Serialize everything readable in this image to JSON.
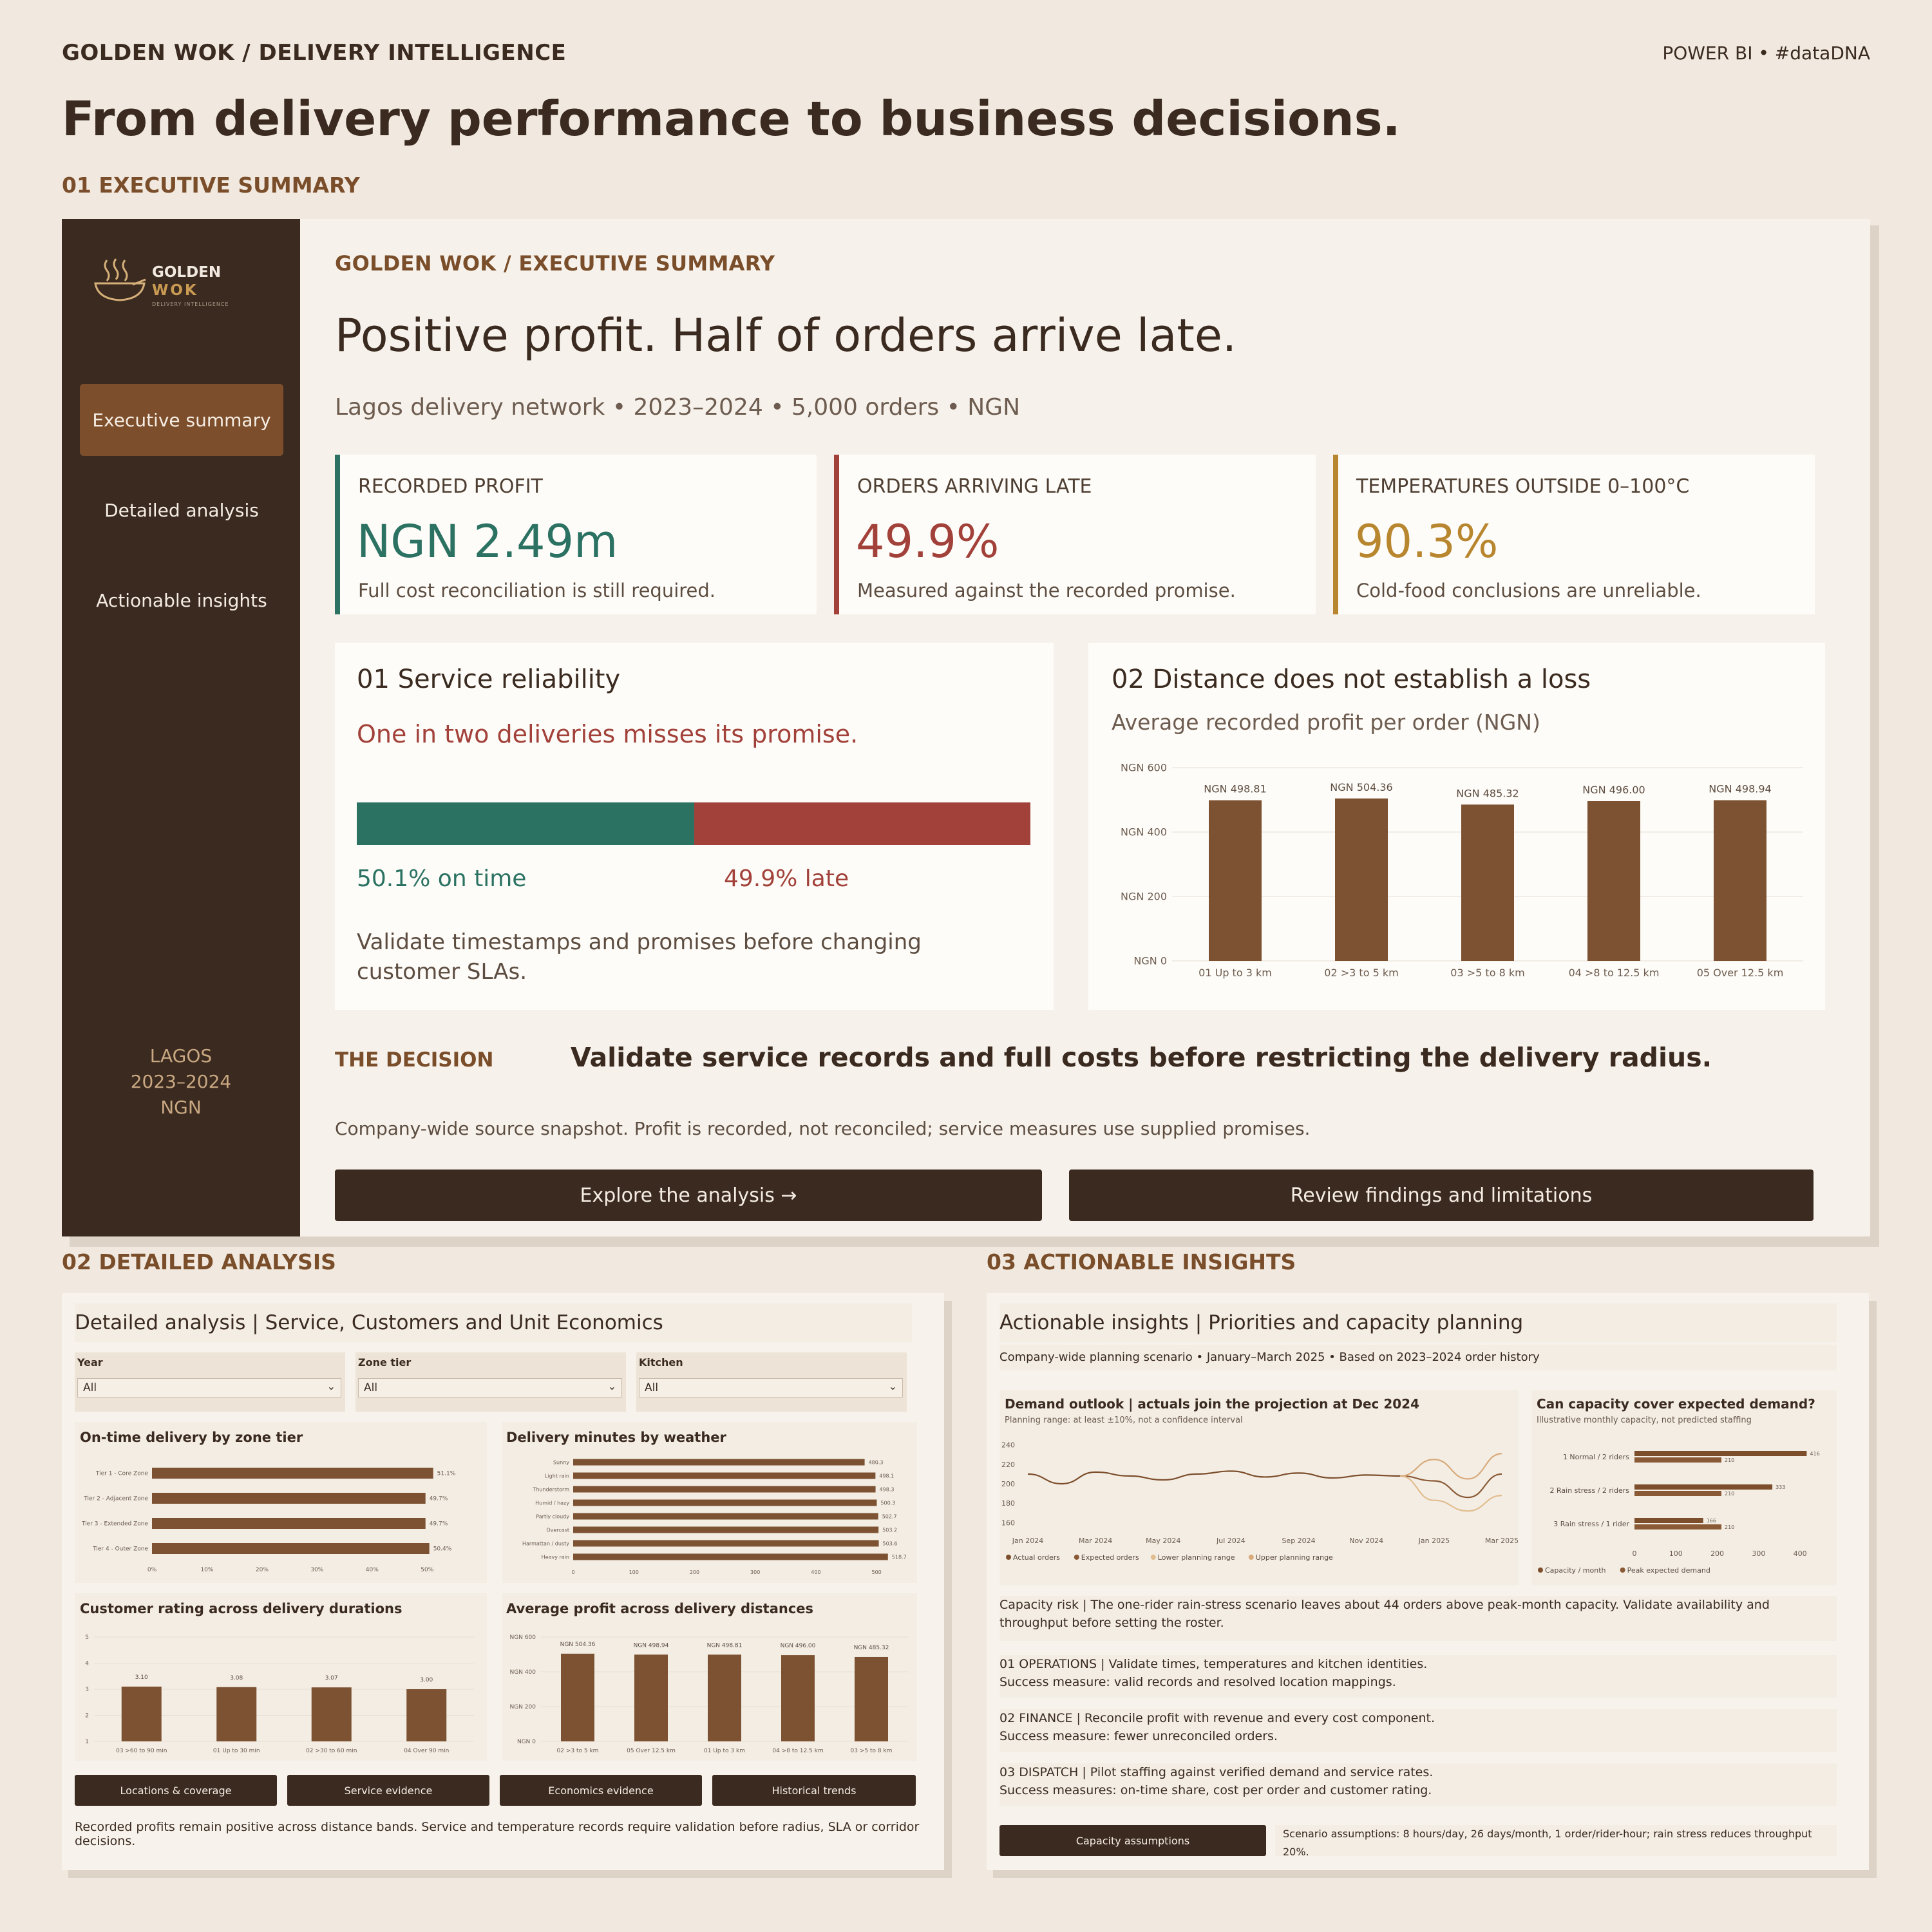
{
  "header": {
    "brand": "GOLDEN WOK  /  DELIVERY INTELLIGENCE",
    "corner": "POWER BI  •  #dataDNA",
    "headline": "From delivery performance to business decisions."
  },
  "sections": {
    "exec": "01  EXECUTIVE SUMMARY",
    "detail": "02  DETAILED ANALYSIS",
    "insights": "03  ACTIONABLE INSIGHTS"
  },
  "sidebar": {
    "logo_line1": "GOLDEN",
    "logo_line2": "WOK",
    "logo_line3": "DELIVERY INTELLIGENCE",
    "nav": [
      "Executive summary",
      "Detailed analysis",
      "Actionable insights"
    ],
    "footer": [
      "LAGOS",
      "2023–2024",
      "NGN"
    ]
  },
  "exec": {
    "breadcrumb": "GOLDEN WOK  /  EXECUTIVE SUMMARY",
    "title": "Positive profit. Half of orders arrive late.",
    "subtitle": "Lagos delivery network  •  2023–2024  •  5,000 orders  •  NGN",
    "kpis": [
      {
        "label": "RECORDED PROFIT",
        "value": "NGN 2.49m",
        "note": "Full cost reconciliation is still required.",
        "color": "#2b7263"
      },
      {
        "label": "ORDERS ARRIVING LATE",
        "value": "49.9%",
        "note": "Measured against the recorded promise.",
        "color": "#a2413a"
      },
      {
        "label": "TEMPERATURES OUTSIDE 0–100°C",
        "value": "90.3%",
        "note": "Cold-food conclusions are unreliable.",
        "color": "#b8862f"
      }
    ],
    "reliability": {
      "title": "01  Service reliability",
      "highlight": "One in two deliveries misses its promise.",
      "on_time_share": 50.1,
      "on_time_label": "50.1% on time",
      "late_label": "49.9% late",
      "note": "Validate timestamps and promises before changing customer SLAs.",
      "on_time_color": "#2b7263",
      "late_color": "#a2413a"
    },
    "distance": {
      "title": "02  Distance does not establish a loss",
      "subtitle": "Average recorded profit per order (NGN)"
    },
    "decision_label": "THE DECISION",
    "decision_text": "Validate service records and full costs before restricting the delivery radius.",
    "footnote": "Company-wide source snapshot. Profit is recorded, not reconciled; service measures use supplied promises.",
    "btn_explore": "Explore the analysis →",
    "btn_review": "Review findings and limitations"
  },
  "detail": {
    "title": "Detailed analysis | Service, Customers and Unit Economics",
    "slicers": [
      {
        "label": "Year",
        "value": "All"
      },
      {
        "label": "Zone tier",
        "value": "All"
      },
      {
        "label": "Kitchen",
        "value": "All"
      }
    ],
    "tiles": {
      "ontime": "On-time delivery by zone tier",
      "weather": "Delivery minutes by weather",
      "rating": "Customer rating across delivery durations",
      "profit": "Average profit across delivery distances"
    },
    "buttons": [
      "Locations & coverage",
      "Service evidence",
      "Economics evidence",
      "Historical trends"
    ],
    "footer": "Recorded profits remain positive across distance bands. Service and temperature records require validation before radius, SLA or corridor decisions."
  },
  "insights": {
    "title": "Actionable insights | Priorities and capacity planning",
    "subtitle": "Company-wide planning scenario • January–March 2025 • Based on 2023–2024 order history",
    "demand_title": "Demand outlook | actuals join the projection at Dec 2024",
    "demand_sub": "Planning range: at least ±10%, not a confidence interval",
    "capacity_title": "Can capacity cover expected demand?",
    "capacity_sub": "Illustrative monthly capacity, not predicted staffing",
    "risk": "Capacity risk  |  The one-rider rain-stress scenario leaves about 44 orders above peak-month capacity. Validate availability and throughput before setting the roster.",
    "actions": [
      {
        "head": "01  OPERATIONS  |  Validate times, temperatures and kitchen identities.",
        "measure": "Success measure: valid records and resolved location mappings."
      },
      {
        "head": "02  FINANCE  |  Reconcile profit with revenue and every cost component.",
        "measure": "Success measure: fewer unreconciled orders."
      },
      {
        "head": "03  DISPATCH  |  Pilot staffing against verified demand and service rates.",
        "measure": "Success measures: on-time share, cost per order and customer rating."
      }
    ],
    "btn_capacity": "Capacity assumptions",
    "assumptions": "Scenario assumptions: 8 hours/day, 26 days/month, 1 order/rider-hour; rain stress reduces throughput 20%."
  },
  "chart_data": [
    {
      "id": "exec-distance",
      "type": "bar",
      "title": "Distance does not establish a loss",
      "ylabel": "Average recorded profit per order (NGN)",
      "categories": [
        "01 Up to 3 km",
        "02 >3 to 5 km",
        "03 >5 to 8 km",
        "04 >8 to 12.5 km",
        "05 Over 12.5 km"
      ],
      "values": [
        498.81,
        504.36,
        485.32,
        496.0,
        498.94
      ],
      "value_labels": [
        "NGN 498.81",
        "NGN 504.36",
        "NGN 485.32",
        "NGN 496.00",
        "NGN 498.94"
      ],
      "ticks": [
        "NGN 0",
        "NGN 200",
        "NGN 400",
        "NGN 600"
      ],
      "ylim": [
        0,
        600
      ],
      "color": "#7d5232"
    },
    {
      "id": "ontime-zone",
      "type": "bar",
      "orientation": "horizontal",
      "title": "On-time delivery by zone tier",
      "categories": [
        "Tier 1 - Core Zone",
        "Tier 2 - Adjacent Zone",
        "Tier 3 - Extended Zone",
        "Tier 4 - Outer Zone"
      ],
      "values": [
        51.1,
        49.7,
        49.7,
        50.4
      ],
      "value_labels": [
        "51.1%",
        "49.7%",
        "49.7%",
        "50.4%"
      ],
      "ticks": [
        "0%",
        "10%",
        "20%",
        "30%",
        "40%",
        "50%"
      ],
      "xlim": [
        0,
        55
      ]
    },
    {
      "id": "weather-minutes",
      "type": "bar",
      "orientation": "horizontal",
      "title": "Delivery minutes by weather",
      "categories": [
        "Sunny",
        "Light rain",
        "Thunderstorm",
        "Humid / hazy",
        "Partly cloudy",
        "Overcast",
        "Harmattan / dusty",
        "Heavy rain"
      ],
      "values": [
        480.3,
        498.1,
        498.3,
        500.3,
        502.7,
        503.2,
        503.6,
        518.7
      ],
      "value_labels": [
        "480.3",
        "498.1",
        "498.3",
        "500.3",
        "502.7",
        "503.2",
        "503.6",
        "518.7"
      ],
      "ticks": [
        "0",
        "100",
        "200",
        "300",
        "400",
        "500"
      ],
      "xlim": [
        0,
        520
      ]
    },
    {
      "id": "rating-duration",
      "type": "bar",
      "title": "Customer rating across delivery durations",
      "categories": [
        "03 >60 to 90 min",
        "01 Up to 30 min",
        "02 >30 to 60 min",
        "04 Over 90 min"
      ],
      "values": [
        3.1,
        3.08,
        3.07,
        3.0
      ],
      "value_labels": [
        "3.10",
        "3.08",
        "3.07",
        "3.00"
      ],
      "ticks": [
        "1",
        "2",
        "3",
        "4",
        "5"
      ],
      "ylim": [
        1,
        5
      ]
    },
    {
      "id": "profit-distance",
      "type": "bar",
      "title": "Average profit across delivery distances",
      "categories": [
        "02 >3 to 5 km",
        "05 Over 12.5 km",
        "01 Up to 3 km",
        "04 >8 to 12.5 km",
        "03 >5 to 8 km"
      ],
      "values": [
        504.36,
        498.94,
        498.81,
        496.0,
        485.32
      ],
      "value_labels": [
        "NGN 504.36",
        "NGN 498.94",
        "NGN 498.81",
        "NGN 496.00",
        "NGN 485.32"
      ],
      "ticks": [
        "NGN 0",
        "NGN 200",
        "NGN 400",
        "NGN 600"
      ],
      "ylim": [
        0,
        600
      ]
    },
    {
      "id": "demand-outlook",
      "type": "line",
      "title": "Demand outlook | actuals join the projection at Dec 2024",
      "x_ticks": [
        "Jan 2024",
        "Mar 2024",
        "May 2024",
        "Jul 2024",
        "Sep 2024",
        "Nov 2024",
        "Jan 2025",
        "Mar 2025"
      ],
      "y_ticks": [
        "160",
        "180",
        "200",
        "220",
        "240"
      ],
      "ylim": [
        155,
        245
      ],
      "x": [
        "Jan 2024",
        "Feb 2024",
        "Mar 2024",
        "Apr 2024",
        "May 2024",
        "Jun 2024",
        "Jul 2024",
        "Aug 2024",
        "Sep 2024",
        "Oct 2024",
        "Nov 2024",
        "Dec 2024",
        "Jan 2025",
        "Feb 2025",
        "Mar 2025"
      ],
      "series": [
        {
          "name": "Actual orders",
          "values": [
            210,
            200,
            212,
            208,
            204,
            210,
            213,
            207,
            211,
            206,
            209,
            208,
            null,
            null,
            null
          ],
          "color": "#7d4e2c"
        },
        {
          "name": "Expected orders",
          "values": [
            null,
            null,
            null,
            null,
            null,
            null,
            null,
            null,
            null,
            null,
            null,
            208,
            203,
            186,
            210
          ],
          "color": "#8a5a36"
        },
        {
          "name": "Lower planning range",
          "values": [
            null,
            null,
            null,
            null,
            null,
            null,
            null,
            null,
            null,
            null,
            null,
            208,
            183,
            172,
            188
          ],
          "color": "#e2bd8f"
        },
        {
          "name": "Upper planning range",
          "values": [
            null,
            null,
            null,
            null,
            null,
            null,
            null,
            null,
            null,
            null,
            null,
            208,
            225,
            205,
            231
          ],
          "color": "#d9aa7a"
        }
      ]
    },
    {
      "id": "capacity",
      "type": "bar",
      "orientation": "horizontal",
      "title": "Can capacity cover expected demand?",
      "categories": [
        "1 Normal / 2 riders",
        "2 Rain stress / 2 riders",
        "3 Rain stress / 1 rider"
      ],
      "series": [
        {
          "name": "Capacity / month",
          "values": [
            416,
            333,
            166
          ],
          "color": "#7d4e2c"
        },
        {
          "name": "Peak expected demand",
          "values": [
            210,
            210,
            210
          ],
          "color": "#8a5a36"
        }
      ],
      "ticks": [
        "0",
        "100",
        "200",
        "300",
        "400"
      ],
      "xlim": [
        0,
        420
      ]
    }
  ]
}
